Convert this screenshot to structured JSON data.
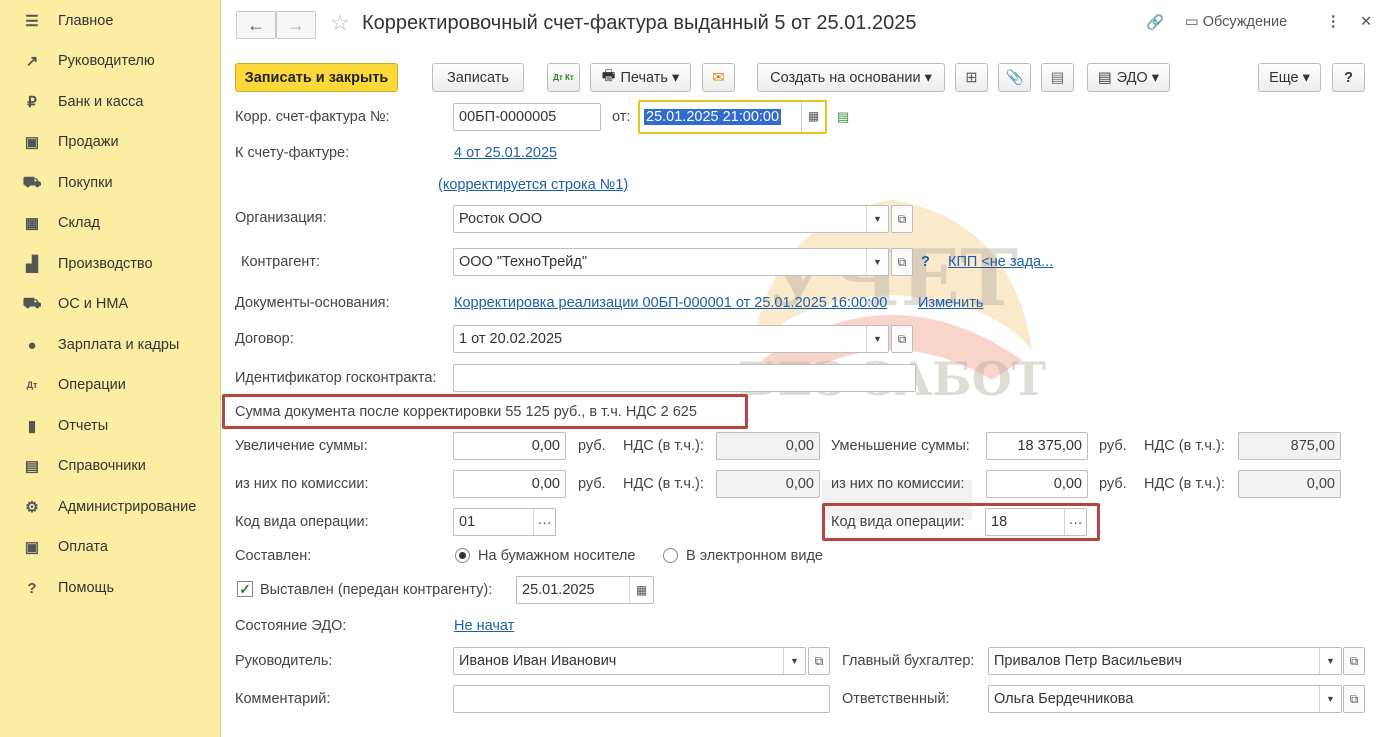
{
  "sidebar": {
    "items": [
      {
        "label": "Главное",
        "icon": "menu-icon",
        "glyph": "☰"
      },
      {
        "label": "Руководителю",
        "icon": "trend-icon",
        "glyph": "↗"
      },
      {
        "label": "Банк и касса",
        "icon": "coin-icon",
        "glyph": "₽"
      },
      {
        "label": "Продажи",
        "icon": "bag-icon",
        "glyph": "▣"
      },
      {
        "label": "Покупки",
        "icon": "cart-icon",
        "glyph": "⛟"
      },
      {
        "label": "Склад",
        "icon": "warehouse-icon",
        "glyph": "▦"
      },
      {
        "label": "Производство",
        "icon": "factory-icon",
        "glyph": "▟"
      },
      {
        "label": "ОС и НМА",
        "icon": "truck-icon",
        "glyph": "⛟"
      },
      {
        "label": "Зарплата и кадры",
        "icon": "person-icon",
        "glyph": "●"
      },
      {
        "label": "Операции",
        "icon": "dtkt-icon",
        "glyph": "Дт"
      },
      {
        "label": "Отчеты",
        "icon": "bar-chart-icon",
        "glyph": "▮"
      },
      {
        "label": "Справочники",
        "icon": "book-icon",
        "glyph": "▤"
      },
      {
        "label": "Администрирование",
        "icon": "gear-icon",
        "glyph": "⚙"
      },
      {
        "label": "Оплата",
        "icon": "wallet-icon",
        "glyph": "▣"
      },
      {
        "label": "Помощь",
        "icon": "help-icon",
        "glyph": "?"
      }
    ]
  },
  "header": {
    "back": "←",
    "forward": "→",
    "star": "☆",
    "title": "Корректировочный счет-фактура выданный 5 от 25.01.2025",
    "link_icon": "🔗",
    "discuss_icon": "▭",
    "discuss": "Обсуждение",
    "more_icon": "⋮",
    "close_icon": "✕"
  },
  "toolbar": {
    "save_close": "Записать и закрыть",
    "save": "Записать",
    "dtkt": "Дт Кт",
    "print_icon": "🖶",
    "print": "Печать ▾",
    "mail": "✉",
    "create_based": "Создать на основании ▾",
    "struct": "⊞",
    "attach": "📎",
    "list": "▤",
    "edo_icon": "▤",
    "edo": "ЭДО ▾",
    "more": "Еще ▾",
    "help": "?"
  },
  "form": {
    "corr_label": "Корр. счет-фактура №:",
    "corr_number": "00БП-0000005",
    "from_label": "от:",
    "date": "25.01.2025 21:00:00",
    "to_invoice_label": "К счету-фактуре:",
    "to_invoice_link": "4 от 25.01.2025",
    "corrected_row": "(корректируется строка №1)",
    "org_label": "Организация:",
    "org_value": "Росток ООО",
    "contragent_label": "Контрагент:",
    "contragent_value": "ООО \"ТехноТрейд\"",
    "question": "?",
    "kpp_link": "КПП <не зада...",
    "basis_label": "Документы-основания:",
    "basis_link": "Корректировка реализации 00БП-000001 от 25.01.2025 16:00:00",
    "change_link": "Изменить",
    "contract_label": "Договор:",
    "contract_value": "1 от 20.02.2025",
    "gov_label": "Идентификатор госконтракта:",
    "gov_value": "",
    "sum_after": "Сумма документа после корректировки 55 125 руб., в т.ч. НДС 2 625",
    "increase_label": "Увеличение суммы:",
    "increase_value": "0,00",
    "rub": "руб.",
    "vat_label": "НДС (в т.ч.):",
    "increase_vat": "0,00",
    "decrease_label": "Уменьшение суммы:",
    "decrease_value": "18 375,00",
    "decrease_vat": "875,00",
    "commission_label": "из них по комиссии:",
    "commission_inc": "0,00",
    "commission_inc_vat": "0,00",
    "commission_dec": "0,00",
    "commission_dec_vat": "0,00",
    "op_code_label": "Код вида операции:",
    "op_code_inc": "01",
    "op_code_dec": "18",
    "composed_label": "Составлен:",
    "paper": "На бумажном носителе",
    "electronic": "В электронном виде",
    "issued_label": "Выставлен (передан контрагенту):",
    "issued_date": "25.01.2025",
    "edo_state_label": "Состояние ЭДО:",
    "edo_state": "Не начат",
    "head_label": "Руководитель:",
    "head_value": "Иванов Иван Иванович",
    "chief_acc_label": "Главный бухгалтер:",
    "chief_acc_value": "Привалов Петр Васильевич",
    "comment_label": "Комментарий:",
    "comment_value": "",
    "responsible_label": "Ответственный:",
    "responsible_value": "Ольга Бердечникова"
  },
  "watermark": {
    "line1": "УЧЕТ",
    "line2": "БЕЗ ЗАБОТ"
  },
  "colors": {
    "sidebar": "#fbeea3",
    "primary_button": "#fcd93b",
    "link": "#1d5fa8",
    "highlight_box": "#b5463c",
    "date_focus": "#e8c21e"
  }
}
